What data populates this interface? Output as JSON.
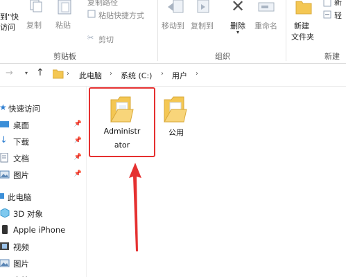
{
  "ribbon": {
    "cut_partial": "剪",
    "copy_path": "复制路径",
    "pin_quick_partial": "到\"快",
    "access_partial": "访问",
    "copy": "复制",
    "paste": "粘贴",
    "paste_shortcut": "粘贴快捷方式",
    "cut": "剪切",
    "clipboard_group": "剪贴板",
    "move_to": "移动到",
    "copy_to": "复制到",
    "delete": "删除",
    "rename": "重命名",
    "organize_group": "组织",
    "new_folder_line1": "新建",
    "new_folder_line2": "文件夹",
    "new_item_partial": "新",
    "easy_access_partial": "轻",
    "new_group": "新建"
  },
  "address": {
    "crumbs": [
      "此电脑",
      "系统 (C:)",
      "用户"
    ]
  },
  "nav": {
    "quick_access": "快速访问",
    "desktop": "桌面",
    "downloads": "下载",
    "documents": "文档",
    "pictures": "图片",
    "this_pc": "此电脑",
    "objects3d": "3D 对象",
    "iphone": "Apple iPhone",
    "videos": "视频",
    "pictures2": "图片",
    "docs_partial": "文档"
  },
  "folders": [
    {
      "name_line1": "Administr",
      "name_line2": "ator"
    },
    {
      "name_line1": "公用"
    }
  ],
  "colors": {
    "highlight_red": "#e53030",
    "folder_yellow": "#f4c753"
  }
}
